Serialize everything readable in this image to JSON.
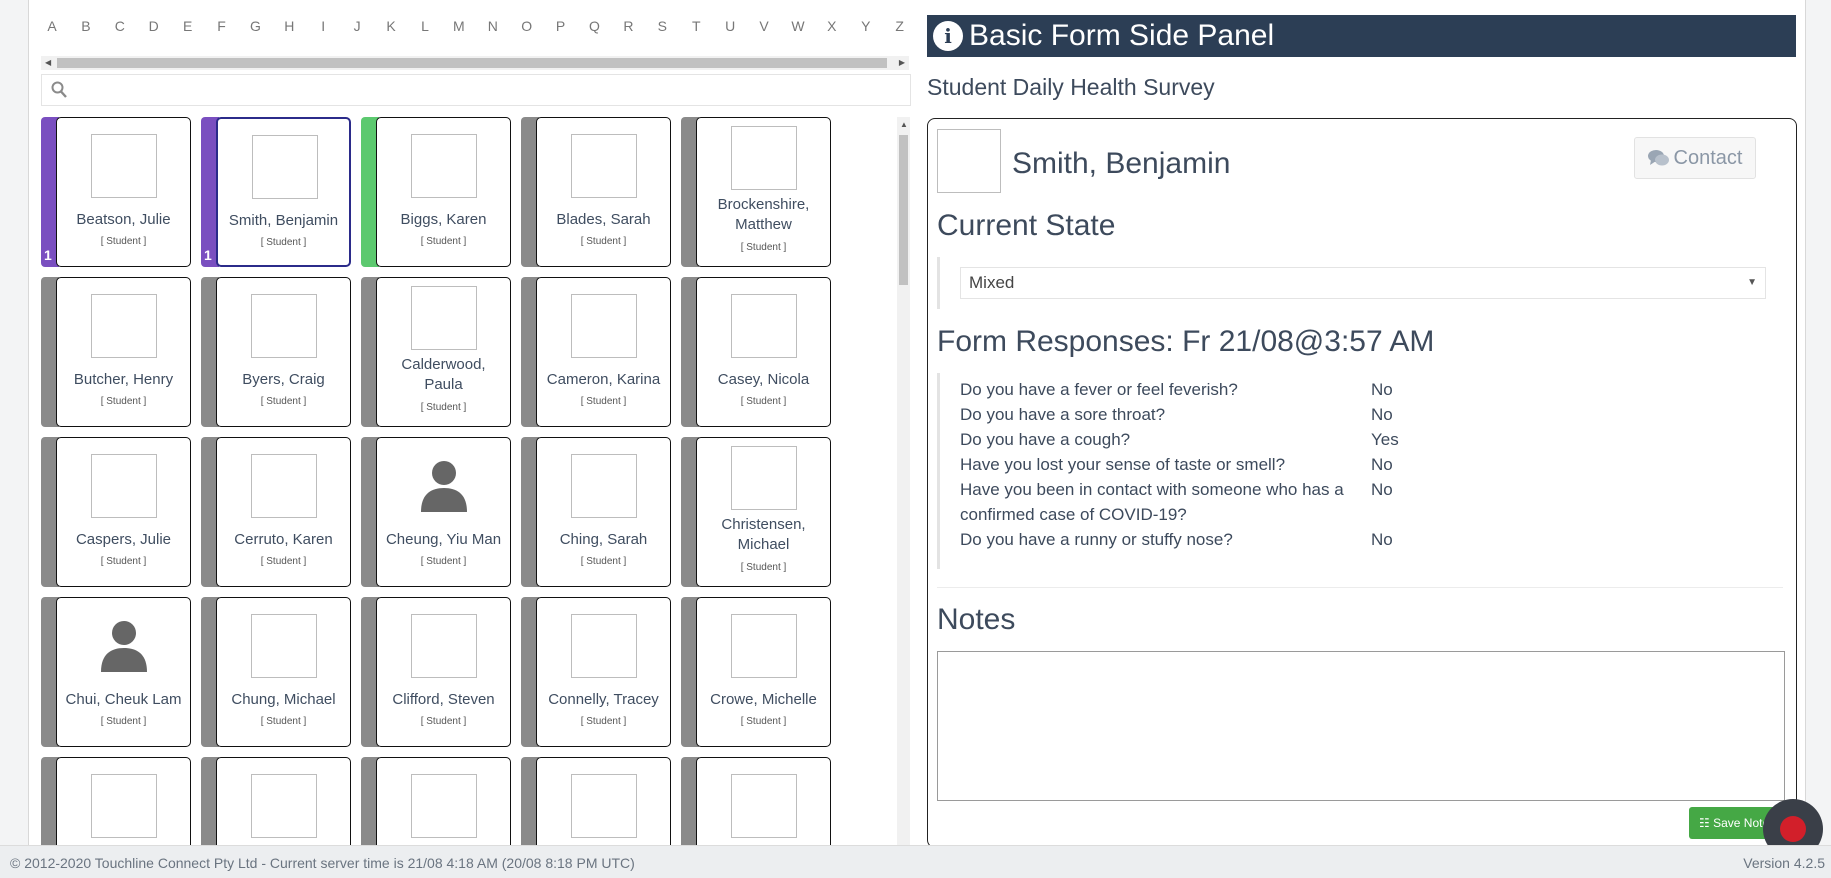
{
  "alphabet": [
    "A",
    "B",
    "C",
    "D",
    "E",
    "F",
    "G",
    "H",
    "I",
    "J",
    "K",
    "L",
    "M",
    "N",
    "O",
    "P",
    "Q",
    "R",
    "S",
    "T",
    "U",
    "V",
    "W",
    "X",
    "Y",
    "Z"
  ],
  "search": {
    "placeholder": ""
  },
  "students": [
    {
      "name": "Beatson, Julie",
      "role": "[ Student ]",
      "stripe": "#7a4fc0",
      "count": "1",
      "photo": "broken"
    },
    {
      "name": "Smith, Benjamin",
      "role": "[ Student ]",
      "stripe": "#7a4fc0",
      "count": "1",
      "photo": "broken",
      "selected": true
    },
    {
      "name": "Biggs, Karen",
      "role": "[ Student ]",
      "stripe": "#5cc96f",
      "photo": "broken"
    },
    {
      "name": "Blades, Sarah",
      "role": "[ Student ]",
      "stripe": "#8a8a8a",
      "photo": "broken"
    },
    {
      "name": "Brockenshire, Matthew",
      "role": "[ Student ]",
      "stripe": "#8a8a8a",
      "photo": "broken",
      "two": true
    },
    {
      "name": "Butcher, Henry",
      "role": "[ Student ]",
      "stripe": "#8a8a8a",
      "photo": "broken"
    },
    {
      "name": "Byers, Craig",
      "role": "[ Student ]",
      "stripe": "#8a8a8a",
      "photo": "broken"
    },
    {
      "name": "Calderwood, Paula",
      "role": "[ Student ]",
      "stripe": "#8a8a8a",
      "photo": "broken",
      "two": true
    },
    {
      "name": "Cameron, Karina",
      "role": "[ Student ]",
      "stripe": "#8a8a8a",
      "photo": "broken"
    },
    {
      "name": "Casey, Nicola",
      "role": "[ Student ]",
      "stripe": "#8a8a8a",
      "photo": "broken"
    },
    {
      "name": "Caspers, Julie",
      "role": "[ Student ]",
      "stripe": "#8a8a8a",
      "photo": "broken"
    },
    {
      "name": "Cerruto, Karen",
      "role": "[ Student ]",
      "stripe": "#8a8a8a",
      "photo": "broken"
    },
    {
      "name": "Cheung, Yiu Man",
      "role": "[ Student ]",
      "stripe": "#8a8a8a",
      "photo": "person-icon"
    },
    {
      "name": "Ching, Sarah",
      "role": "[ Student ]",
      "stripe": "#8a8a8a",
      "photo": "broken"
    },
    {
      "name": "Christensen, Michael",
      "role": "[ Student ]",
      "stripe": "#8a8a8a",
      "photo": "broken",
      "two": true
    },
    {
      "name": "Chui, Cheuk Lam",
      "role": "[ Student ]",
      "stripe": "#8a8a8a",
      "photo": "person-icon"
    },
    {
      "name": "Chung, Michael",
      "role": "[ Student ]",
      "stripe": "#8a8a8a",
      "photo": "broken"
    },
    {
      "name": "Clifford, Steven",
      "role": "[ Student ]",
      "stripe": "#8a8a8a",
      "photo": "broken"
    },
    {
      "name": "Connelly, Tracey",
      "role": "[ Student ]",
      "stripe": "#8a8a8a",
      "photo": "broken"
    },
    {
      "name": "Crowe, Michelle",
      "role": "[ Student ]",
      "stripe": "#8a8a8a",
      "photo": "broken"
    },
    {
      "name": "",
      "role": "",
      "stripe": "#8a8a8a",
      "photo": "broken"
    },
    {
      "name": "",
      "role": "",
      "stripe": "#8a8a8a",
      "photo": "broken"
    },
    {
      "name": "",
      "role": "",
      "stripe": "#8a8a8a",
      "photo": "broken"
    },
    {
      "name": "",
      "role": "",
      "stripe": "#8a8a8a",
      "photo": "broken"
    },
    {
      "name": "",
      "role": "",
      "stripe": "#8a8a8a",
      "photo": "broken"
    }
  ],
  "panel": {
    "header_title": "Basic Form Side Panel",
    "info_icon": "info-icon",
    "survey_title": "Student Daily Health Survey",
    "student_name": "Smith, Benjamin",
    "contact_label": "Contact",
    "current_state_heading": "Current State",
    "current_state_value": "Mixed",
    "responses_heading": "Form Responses: Fr 21/08@3:57 AM",
    "responses": [
      {
        "q": "Do you have a fever or feel feverish?",
        "a": "No"
      },
      {
        "q": "Do you have a sore throat?",
        "a": "No"
      },
      {
        "q": "Do you have a cough?",
        "a": "Yes"
      },
      {
        "q": "Have you lost your sense of taste or smell?",
        "a": "No"
      },
      {
        "q": "Have you been in contact with someone who has a confirmed case of COVID-19?",
        "a": "No"
      },
      {
        "q": "Do you have a runny or stuffy nose?",
        "a": "No"
      }
    ],
    "notes_heading": "Notes",
    "notes_value": "",
    "save_label": "Save Notes"
  },
  "footer": {
    "copyright": "© 2012-2020 Touchline Connect Pty Ltd - Current server time is 21/08 4:18 AM (20/08 8:18 PM UTC)",
    "version": "Version 4.2.5"
  },
  "colors": {
    "header_bg": "#2c3e55",
    "accent_purple": "#7a4fc0",
    "accent_green": "#5cc96f",
    "save_green": "#45a845"
  }
}
